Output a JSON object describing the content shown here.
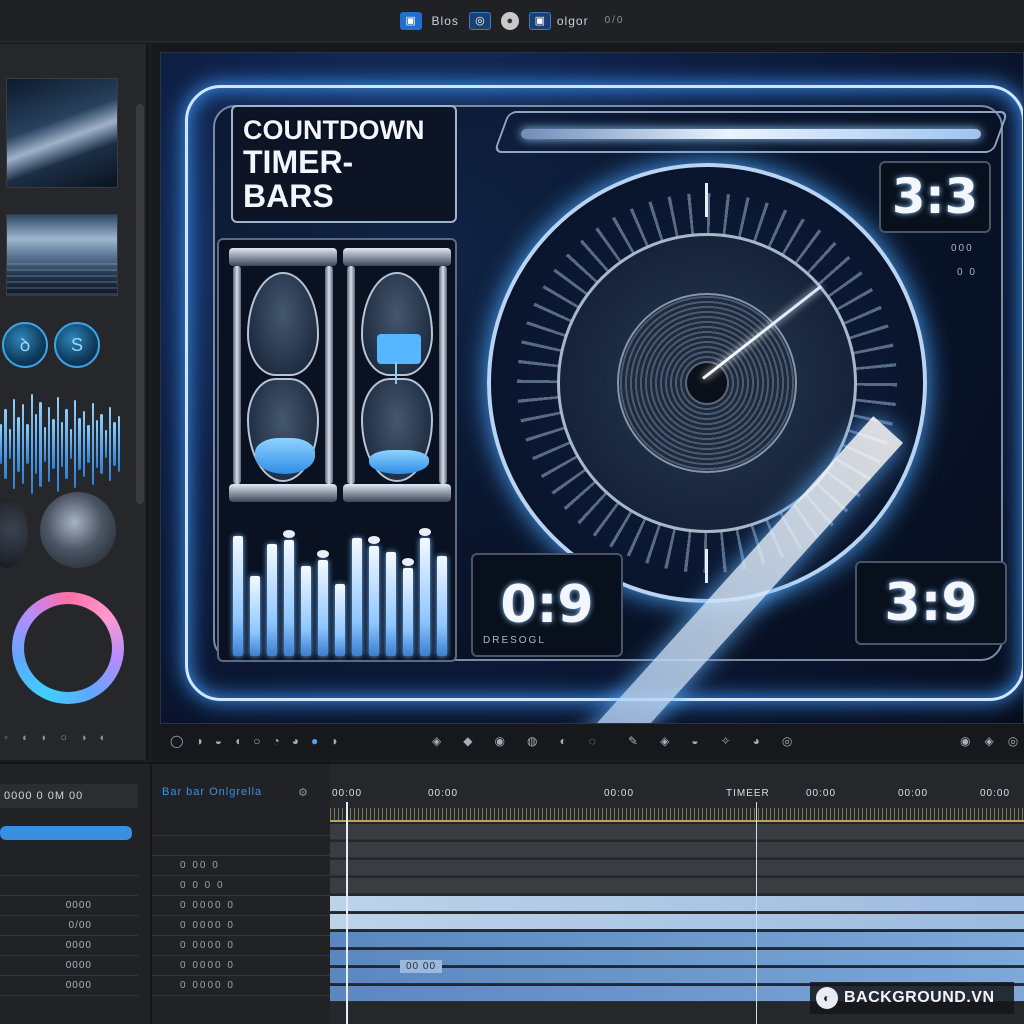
{
  "topbar": {
    "items": [
      {
        "icon": "square-icon",
        "label": ""
      },
      {
        "icon": "",
        "label": "Blos"
      },
      {
        "icon": "circle-icon",
        "label": ""
      },
      {
        "icon": "avatar-icon",
        "label": ""
      },
      {
        "icon": "square-icon",
        "label": "olgor"
      },
      {
        "icon": "",
        "label": "0/0"
      }
    ]
  },
  "preview": {
    "title_line1": "COUNTDOWN",
    "title_line2": "TIMER-",
    "title_line3": "BARS",
    "readout_top": "3:3",
    "readout_left": "0:9",
    "readout_left_label": "DRESOGL",
    "readout_right": "3:9",
    "small_top": "000",
    "small_top2": "0 0"
  },
  "sidebar": {
    "knob1": "ꝺ",
    "knob2": "S"
  },
  "timeline": {
    "header_left": "0000 0 0M 00",
    "track_title": "Bar bar Onlgrella",
    "ruler": [
      "00:00",
      "00:00",
      "00:00",
      "TIMEER",
      "00:00",
      "00:00",
      "00:00"
    ],
    "clip_label": "00 00",
    "left_rows": [
      "",
      "",
      "0000",
      "0/00",
      "0000",
      "0000",
      "0000"
    ],
    "mid_rows": [
      "0 00 0",
      "0 0 0 0",
      "0 0000 0",
      "0 0000 0",
      "0 0000 0",
      "0 0000 0",
      "0 0000 0"
    ]
  },
  "watermark": "BACKGROUND.VN",
  "colors": {
    "accent": "#3a8fe0",
    "glow": "#5fb0ff",
    "panel": "#26272b"
  }
}
